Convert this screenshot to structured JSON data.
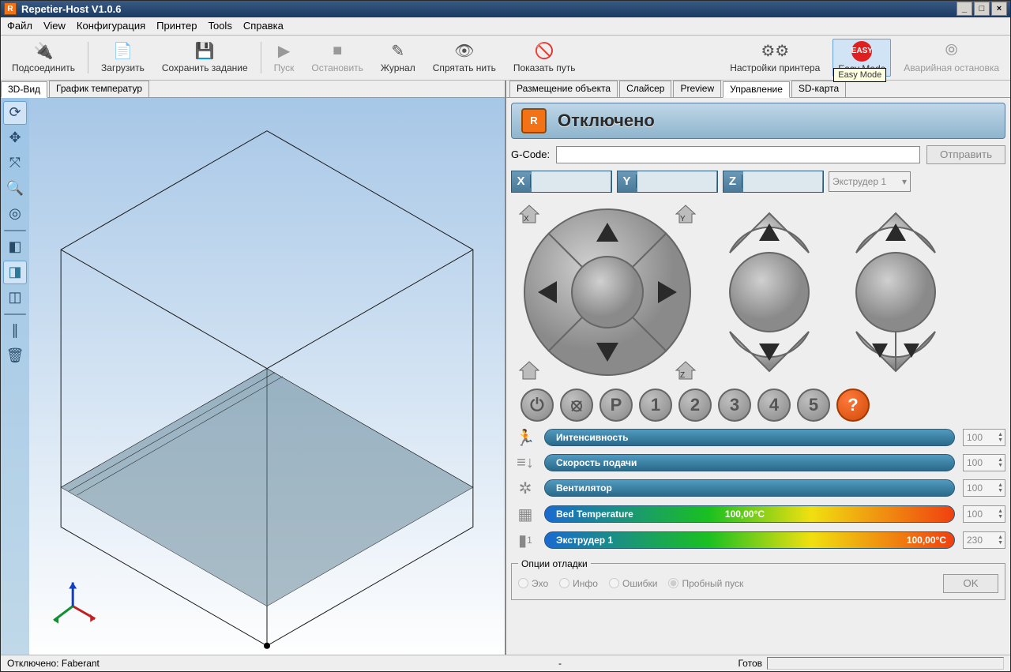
{
  "window": {
    "title": "Repetier-Host V1.0.6"
  },
  "menu": {
    "items": [
      "Файл",
      "View",
      "Конфигурация",
      "Принтер",
      "Tools",
      "Справка"
    ]
  },
  "toolbar": {
    "connect": "Подсоединить",
    "load": "Загрузить",
    "save": "Сохранить задание",
    "start": "Пуск",
    "stop": "Остановить",
    "log": "Журнал",
    "hide_filament": "Спрятать нить",
    "show_travel": "Показать путь",
    "printer_settings": "Настройки принтера",
    "easy_mode": "Easy Mode",
    "emergency_stop": "Аварийная остановка",
    "tooltip_easy": "Easy Mode"
  },
  "left_tabs": {
    "view3d": "3D-Вид",
    "temp_graph": "График температур"
  },
  "right_tabs": {
    "object_placement": "Размещение объекта",
    "slicer": "Слайсер",
    "preview": "Preview",
    "manual": "Управление",
    "sdcard": "SD-карта"
  },
  "control": {
    "status": "Отключено",
    "gcode_label": "G-Code:",
    "send": "Отправить",
    "axes": {
      "x": "X",
      "y": "Y",
      "z": "Z"
    },
    "extruder_selected": "Экструдер 1",
    "action_labels": {
      "power": "⏻",
      "motor": "⦻",
      "park": "P",
      "n1": "1",
      "n2": "2",
      "n3": "3",
      "n4": "4",
      "n5": "5",
      "help": "?"
    },
    "sliders": {
      "speed": {
        "label": "Интенсивность",
        "value": "100"
      },
      "flow": {
        "label": "Скорость подачи",
        "value": "100"
      },
      "fan": {
        "label": "Вентилятор",
        "value": "100"
      },
      "bed": {
        "label": "Bed Temperature",
        "temp": "100,00°C",
        "value": "100"
      },
      "extr": {
        "label": "Экструдер 1",
        "temp": "100,00°C",
        "value": "230",
        "num": "1"
      }
    },
    "debug": {
      "title": "Опции отладки",
      "echo": "Эхо",
      "info": "Инфо",
      "errors": "Ошибки",
      "dryrun": "Пробный пуск",
      "ok": "OK"
    }
  },
  "status": {
    "left": "Отключено: Faberant",
    "mid": "-",
    "right": "Готов"
  }
}
